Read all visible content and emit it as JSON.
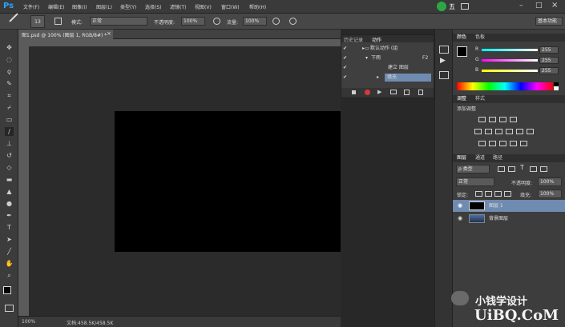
{
  "app": {
    "logo": "Ps"
  },
  "menu": [
    "文件(F)",
    "编辑(E)",
    "图像(I)",
    "图层(L)",
    "类型(Y)",
    "选择(S)",
    "滤镜(T)",
    "视图(V)",
    "窗口(W)",
    "帮助(H)"
  ],
  "window_controls": {
    "badge": "五",
    "minimize": "–",
    "maximize": "□",
    "close": "×"
  },
  "options": {
    "brush_size": "13",
    "mode_label": "模式:",
    "mode_value": "正常",
    "opacity_label": "不透明度:",
    "opacity_value": "100%",
    "flow_label": "流量:",
    "flow_value": "100%",
    "workspace": "基本功能"
  },
  "document": {
    "tab_title": "图1.psd @ 100% (图层 1, RGB/8#) *",
    "close": "×"
  },
  "status": {
    "zoom": "100%",
    "doc_info": "文档:458.5K/458.5K"
  },
  "actions_panel": {
    "tabs": [
      "历史记录",
      "动作"
    ],
    "rows": [
      {
        "label": "默认动作 (组",
        "shortcut": ""
      },
      {
        "label": "下雨",
        "shortcut": "F2"
      },
      {
        "label": "建立 图层",
        "shortcut": ""
      },
      {
        "label": "填充",
        "shortcut": ""
      }
    ]
  },
  "color_panel": {
    "tabs": [
      "颜色",
      "色板"
    ],
    "channels": [
      {
        "name": "R",
        "value": "255"
      },
      {
        "name": "G",
        "value": "255"
      },
      {
        "name": "B",
        "value": "255"
      }
    ]
  },
  "adjustments_panel": {
    "tabs": [
      "调整",
      "样式"
    ],
    "title": "添加调整"
  },
  "layers_panel": {
    "tabs": [
      "图层",
      "通道",
      "路径"
    ],
    "filter": "ρ 类型",
    "blend_mode": "正常",
    "opacity_label": "不透明度:",
    "opacity_value": "100%",
    "lock_label": "锁定:",
    "fill_label": "填充:",
    "fill_value": "100%",
    "layers": [
      {
        "name": "图层 1",
        "selected": true
      },
      {
        "name": "背景图层",
        "selected": false
      }
    ]
  },
  "watermark": {
    "text": "小钱学设计",
    "site": "UiBQ.CoM"
  },
  "colors": {
    "accent": "#2fa3f5",
    "selected_row": "#6f8bb0",
    "canvas": "#000000"
  }
}
